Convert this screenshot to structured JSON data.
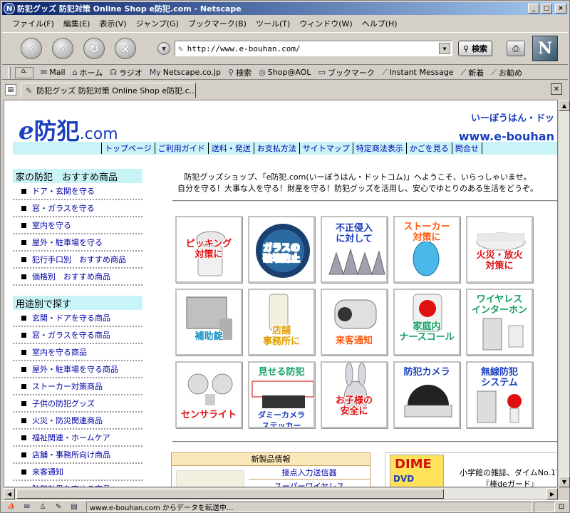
{
  "window": {
    "title": "防犯グッズ 防犯対策 Online Shop e防犯.com - Netscape",
    "controls": [
      "_",
      "□",
      "×"
    ]
  },
  "menu": [
    "ファイル(F)",
    "編集(E)",
    "表示(V)",
    "ジャンプ(G)",
    "ブックマーク(B)",
    "ツール(T)",
    "ウィンドウ(W)",
    "ヘルプ(H)"
  ],
  "nav": {
    "url": "http://www.e-bouhan.com/",
    "search_label": "検索",
    "logo_letter": "N"
  },
  "personal_toolbar": [
    {
      "icon": "mail-icon",
      "glyph": "✉",
      "label": "Mail"
    },
    {
      "icon": "home-icon",
      "glyph": "⌂",
      "label": "ホーム"
    },
    {
      "icon": "headphones-icon",
      "glyph": "☊",
      "label": "ラジオ"
    },
    {
      "icon": "my-icon",
      "glyph": "My",
      "label": "Netscape.co.jp"
    },
    {
      "icon": "search-icon",
      "glyph": "⚲",
      "label": "検索"
    },
    {
      "icon": "aol-icon",
      "glyph": "◎",
      "label": "Shop@AOL"
    },
    {
      "icon": "folder-icon",
      "glyph": "▭",
      "label": "ブックマーク"
    },
    {
      "icon": "bookmark-icon",
      "glyph": "⟋",
      "label": "Instant Message"
    },
    {
      "icon": "bookmark-icon",
      "glyph": "⟋",
      "label": "新着"
    },
    {
      "icon": "bookmark-icon",
      "glyph": "⟋",
      "label": "お勧め"
    }
  ],
  "tab": {
    "label": "防犯グッズ 防犯対策 Online Shop e防犯.c..."
  },
  "page": {
    "logo": {
      "e": "e",
      "kanji": "防犯",
      "com": ".com"
    },
    "tagline": {
      "yomi": "いーぼうはん・ドッ",
      "url": "www.e-bouhan"
    },
    "topnav": [
      "トップページ",
      "ご利用ガイド",
      "送料・発送",
      "お支払方法",
      "サイトマップ",
      "特定商法表示",
      "かごを見る",
      "問合せ"
    ],
    "sidebar": {
      "section1_title": "家の防犯　おすすめ商品",
      "section1_items": [
        "ドア・玄関を守る",
        "窓・ガラスを守る",
        "室内を守る",
        "屋外・駐車場を守る",
        "犯行手口別　おすすめ商品",
        "価格別　おすすめ商品"
      ],
      "section2_title": "用途別で探す",
      "section2_items": [
        "玄関・ドアを守る商品",
        "窓・ガラスを守る商品",
        "室内を守る商品",
        "屋外・駐車場を守る商品",
        "ストーカー対策商品",
        "子供の防犯グッズ",
        "火災・防災関連商品",
        "福祉関連・ホームケア",
        "店舗・事務所向け商品",
        "来客通知",
        "防犯効果を高める商品"
      ]
    },
    "welcome": {
      "line1": "防犯グッズショップ、「e防犯.com(いーぼうはん・ドットコム)」へようこそ、いらっしゃいませ。",
      "line2": "自分を守る！大事な人を守る！財産を守る！防犯グッズを活用し、安心でゆとりのある生活をどうぞ。"
    },
    "tiles": [
      {
        "name": "tile-pickpocket",
        "label": "ピッキング\n対策に",
        "color": "#e01010"
      },
      {
        "name": "tile-glass",
        "label": "ガラスの\n破壊防止",
        "color": "#ffffff"
      },
      {
        "name": "tile-intrusion",
        "label": "不正侵入\nに対して",
        "color": "#1a3fbf"
      },
      {
        "name": "tile-stalker",
        "label": "ストーカー\n対策に",
        "color": "#ff5a10"
      },
      {
        "name": "tile-fire",
        "label": "火災・放火\n対策に",
        "color": "#e01010"
      },
      {
        "name": "tile-auxlock",
        "label": "補助錠",
        "color": "#1090c0"
      },
      {
        "name": "tile-shop",
        "label": "店舗\n事務所に",
        "color": "#e0a000"
      },
      {
        "name": "tile-visitor",
        "label": "来客通知",
        "color": "#ff5a10"
      },
      {
        "name": "tile-nursecall",
        "label": "家庭内\nナースコール",
        "color": "#10a060"
      },
      {
        "name": "tile-intercom",
        "label": "ワイヤレス\nインターホン",
        "color": "#10a060"
      },
      {
        "name": "tile-sensorlight",
        "label": "センサライト",
        "color": "#e01010"
      },
      {
        "name": "tile-showcam",
        "label": "見せる防犯",
        "sub": "ダミーカメラ\nステッカー",
        "color": "#10a060"
      },
      {
        "name": "tile-children",
        "label": "お子様の\n安全に",
        "color": "#e01010"
      },
      {
        "name": "tile-camera",
        "label": "防犯カメラ",
        "color": "#1a3fbf"
      },
      {
        "name": "tile-wireless",
        "label": "無線防犯\nシステム",
        "color": "#1a3fbf"
      }
    ],
    "newbox": {
      "header": "新製品情報",
      "rows": [
        "接点入力送信器",
        "スーパーワイヤレス"
      ]
    },
    "magbox": {
      "cover_title": "DIME",
      "cover_sub": "DVD",
      "line1": "小学館の雑誌、ダイムNo.17",
      "line2": "『棒deガード』"
    }
  },
  "status": {
    "message": "www.e-bouhan.com からデータを転送中..."
  }
}
